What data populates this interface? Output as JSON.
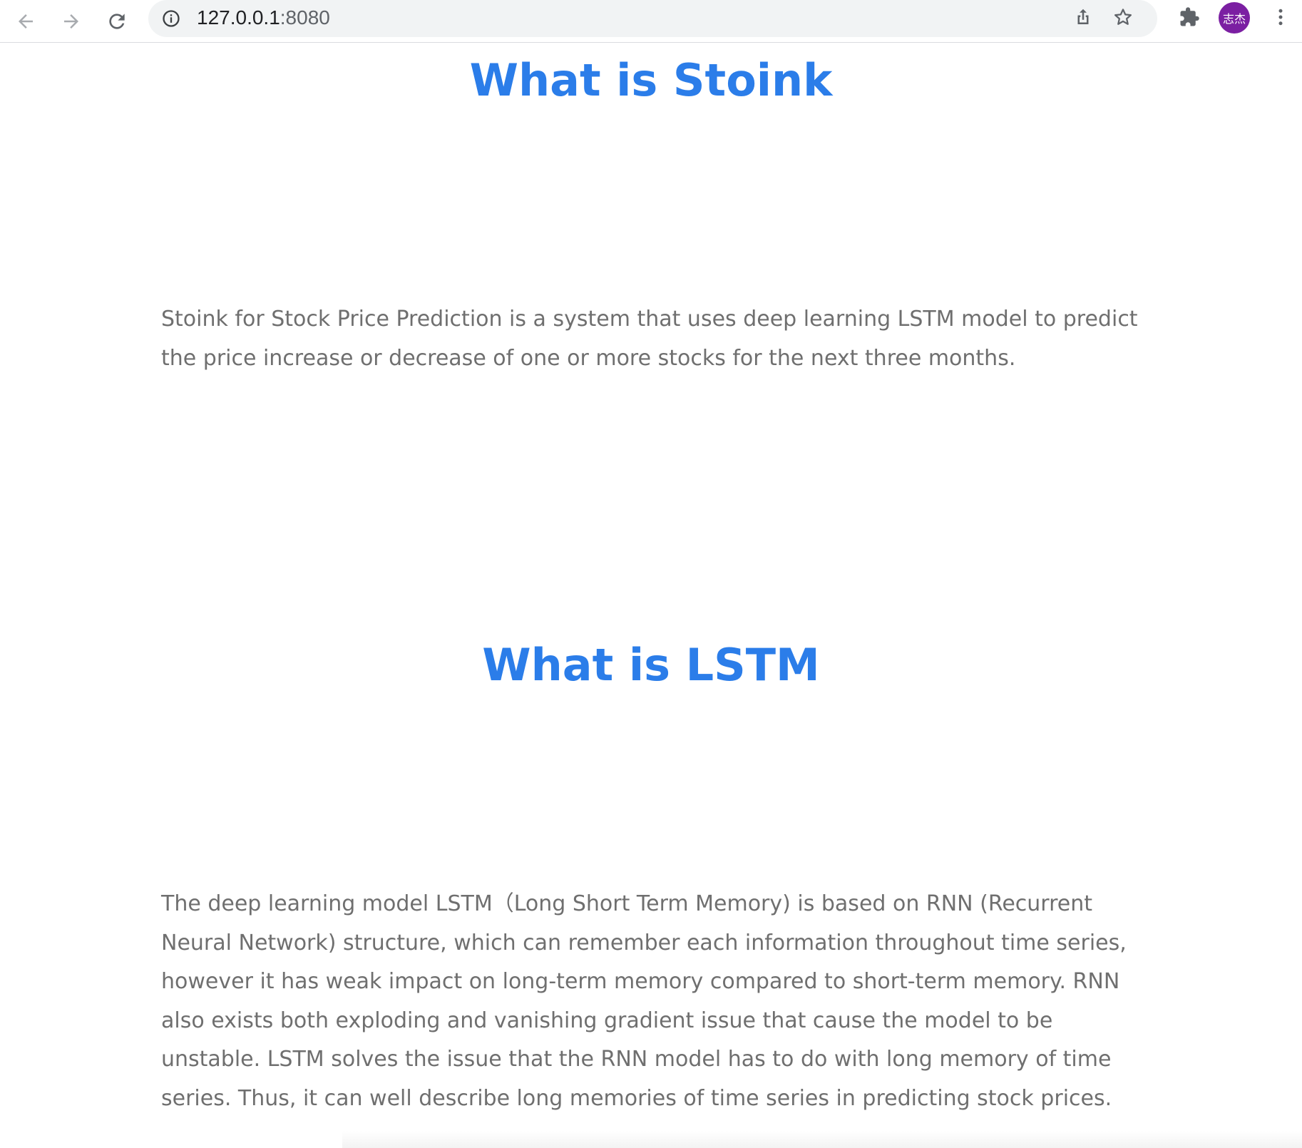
{
  "browser": {
    "url_host": "127.0.0.1",
    "url_port": ":8080",
    "avatar_text": "志杰",
    "icons": {
      "back": "arrow-left-icon",
      "forward": "arrow-right-icon",
      "reload": "reload-icon",
      "site_info": "info-icon",
      "share": "share-icon",
      "bookmark": "star-icon",
      "extensions": "puzzle-icon",
      "menu": "more-vert-icon"
    },
    "colors": {
      "avatar_bg": "#7b1fa2",
      "omnibox_bg": "#f1f3f4"
    }
  },
  "page": {
    "colors": {
      "heading": "#2b7de9",
      "body_text": "#6f6f6f"
    },
    "sections": [
      {
        "title": "What is Stoink",
        "body": "Stoink for Stock Price Prediction is a system that uses deep learning LSTM model to predict the price increase or decrease of one or more stocks for the next three months."
      },
      {
        "title": "What is LSTM",
        "body": "The deep learning model LSTM（Long Short Term Memory) is based on RNN (Recurrent Neural Network) structure, which can remember each information throughout time series, however it has weak impact on long-term memory compared to short-term memory. RNN also exists both exploding and vanishing gradient issue that cause the model to be unstable. LSTM solves the issue that the RNN model has to do with long memory of time series. Thus, it can well describe long memories of time series in predicting stock prices."
      }
    ]
  }
}
